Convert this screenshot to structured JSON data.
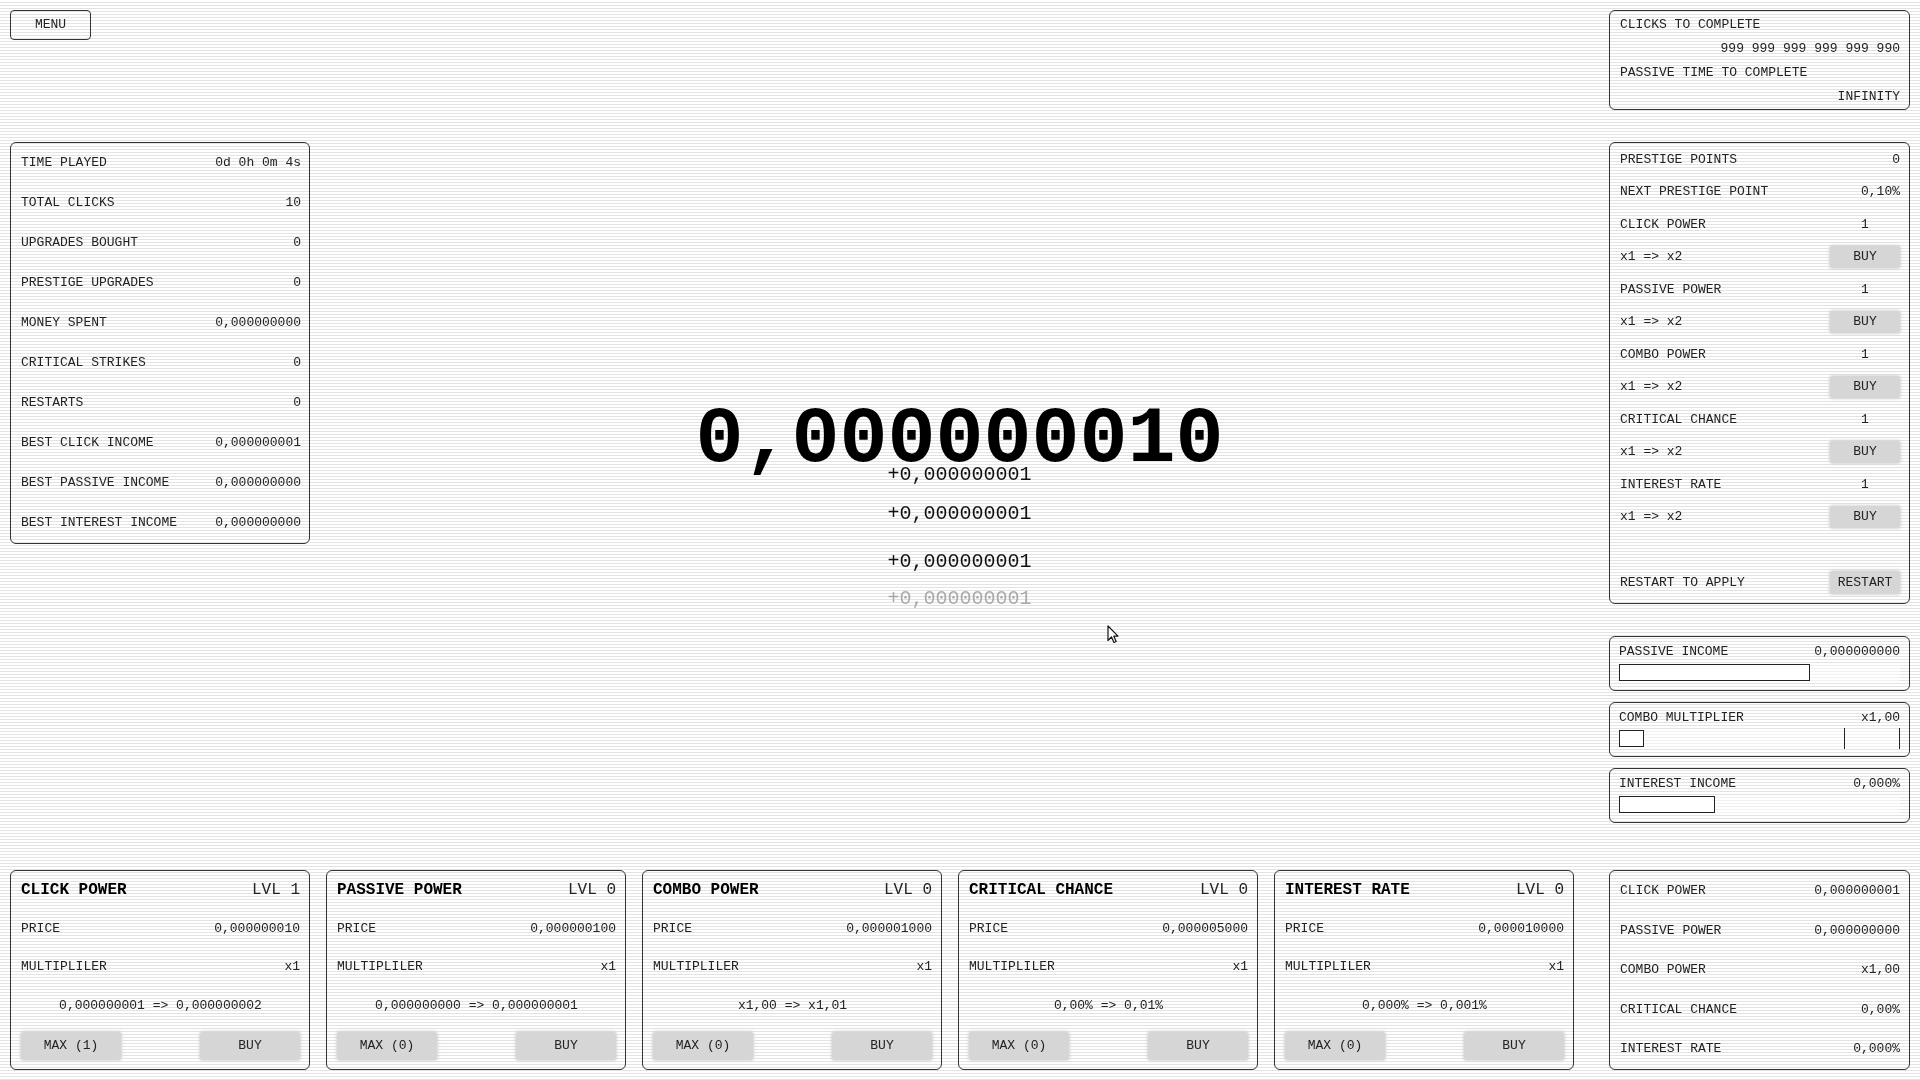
{
  "menu_button": {
    "label": "MENU"
  },
  "stats": [
    {
      "label": "TIME PLAYED",
      "value": "0d 0h 0m 4s"
    },
    {
      "label": "TOTAL CLICKS",
      "value": "10"
    },
    {
      "label": "UPGRADES BOUGHT",
      "value": "0"
    },
    {
      "label": "PRESTIGE UPGRADES",
      "value": "0"
    },
    {
      "label": "MONEY SPENT",
      "value": "0,000000000"
    },
    {
      "label": "CRITICAL STRIKES",
      "value": "0"
    },
    {
      "label": "RESTARTS",
      "value": "0"
    },
    {
      "label": "BEST CLICK INCOME",
      "value": "0,000000001"
    },
    {
      "label": "BEST PASSIVE INCOME",
      "value": "0,000000000"
    },
    {
      "label": "BEST INTEREST INCOME",
      "value": "0,000000000"
    }
  ],
  "balance": "0,000000010",
  "floating_gains": [
    {
      "text": "+0,000000001",
      "faded": false
    },
    {
      "text": "+0,000000001",
      "faded": false
    },
    {
      "text": "+0,000000001",
      "faded": false
    },
    {
      "text": "+0,000000001",
      "faded": true
    }
  ],
  "completion": [
    {
      "label": "CLICKS TO COMPLETE",
      "value": "999 999 999 999 999 990"
    },
    {
      "label": "PASSIVE TIME TO COMPLETE",
      "value": "INFINITY"
    }
  ],
  "prestige": {
    "points": {
      "label": "PRESTIGE POINTS",
      "value": "0"
    },
    "next_point": {
      "label": "NEXT PRESTIGE POINT",
      "value": "0,10%"
    },
    "upgrades": [
      {
        "name": "CLICK POWER",
        "value": "1",
        "change": "x1 => x2",
        "button": "BUY"
      },
      {
        "name": "PASSIVE POWER",
        "value": "1",
        "change": "x1 => x2",
        "button": "BUY"
      },
      {
        "name": "COMBO POWER",
        "value": "1",
        "change": "x1 => x2",
        "button": "BUY"
      },
      {
        "name": "CRITICAL CHANCE",
        "value": "1",
        "change": "x1 => x2",
        "button": "BUY"
      },
      {
        "name": "INTEREST RATE",
        "value": "1",
        "change": "x1 => x2",
        "button": "BUY"
      }
    ],
    "restart": {
      "label": "RESTART TO APPLY",
      "button": "RESTART"
    }
  },
  "meters": [
    {
      "kind": "bar",
      "label": "PASSIVE INCOME",
      "value": "0,000000000",
      "level": 0.68
    },
    {
      "kind": "combo",
      "label": "COMBO MULTIPLIER",
      "value": "x1,00",
      "level": 0.09
    },
    {
      "kind": "bar",
      "label": "INTEREST INCOME",
      "value": "0,000%",
      "level": 0.34
    }
  ],
  "upgrade_cards": [
    {
      "title": "CLICK POWER",
      "lvl": "LVL 1",
      "price_label": "PRICE",
      "price": "0,000000010",
      "multiplier_label": "MULTIPLILER",
      "multiplier": "x1",
      "change": "0,000000001 => 0,000000002",
      "max_button": "MAX (1)",
      "buy_button": "BUY"
    },
    {
      "title": "PASSIVE POWER",
      "lvl": "LVL 0",
      "price_label": "PRICE",
      "price": "0,000000100",
      "multiplier_label": "MULTIPLILER",
      "multiplier": "x1",
      "change": "0,000000000 => 0,000000001",
      "max_button": "MAX (0)",
      "buy_button": "BUY"
    },
    {
      "title": "COMBO POWER",
      "lvl": "LVL 0",
      "price_label": "PRICE",
      "price": "0,000001000",
      "multiplier_label": "MULTIPLILER",
      "multiplier": "x1",
      "change": "x1,00 => x1,01",
      "max_button": "MAX (0)",
      "buy_button": "BUY"
    },
    {
      "title": "CRITICAL CHANCE",
      "lvl": "LVL 0",
      "price_label": "PRICE",
      "price": "0,000005000",
      "multiplier_label": "MULTIPLILER",
      "multiplier": "x1",
      "change": "0,00% => 0,01%",
      "max_button": "MAX (0)",
      "buy_button": "BUY"
    },
    {
      "title": "INTEREST RATE",
      "lvl": "LVL 0",
      "price_label": "PRICE",
      "price": "0,000010000",
      "multiplier_label": "MULTIPLILER",
      "multiplier": "x1",
      "change": "0,000% => 0,001%",
      "max_button": "MAX (0)",
      "buy_button": "BUY"
    }
  ],
  "summary": [
    {
      "label": "CLICK POWER",
      "value": "0,000000001"
    },
    {
      "label": "PASSIVE POWER",
      "value": "0,000000000"
    },
    {
      "label": "COMBO POWER",
      "value": "x1,00"
    },
    {
      "label": "CRITICAL CHANCE",
      "value": "0,00%"
    },
    {
      "label": "INTEREST RATE",
      "value": "0,000%"
    }
  ]
}
